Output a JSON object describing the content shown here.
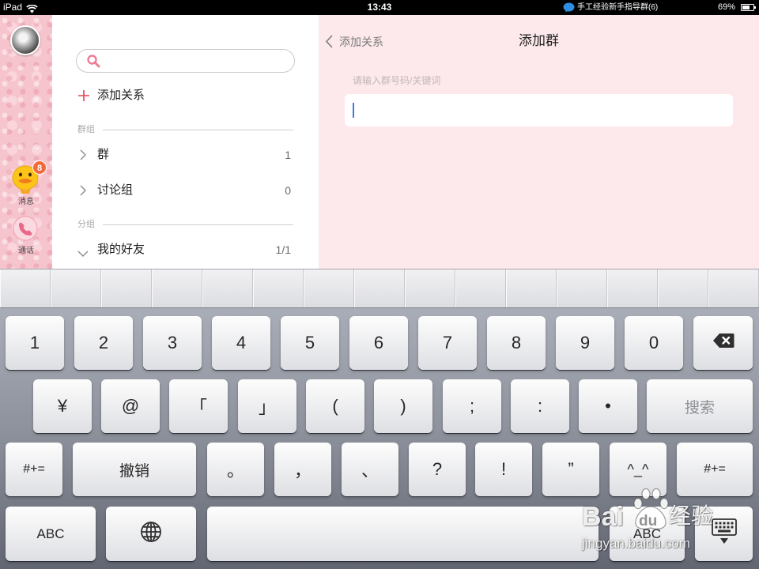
{
  "status_bar": {
    "device": "iPad",
    "time": "13:43",
    "notification_icon": "chat-bubble-icon",
    "notification": "手工经验新手指导群(6)",
    "battery": "69%",
    "battery_level": 0.69
  },
  "sidebar": {
    "items": [
      {
        "label": "消息",
        "badge": "8",
        "icon": "duck-icon"
      },
      {
        "label": "通话",
        "icon": "phone-icon"
      }
    ]
  },
  "contacts": {
    "search_icon": "search-icon",
    "add_relation": "添加关系",
    "sections": [
      {
        "title": "群组",
        "rows": [
          {
            "label": "群",
            "count": "1",
            "icon": "chevron-right-icon"
          },
          {
            "label": "讨论组",
            "count": "0",
            "icon": "chevron-right-icon"
          }
        ]
      },
      {
        "title": "分组",
        "rows": [
          {
            "label": "我的好友",
            "count": "1/1",
            "icon": "chevron-down-icon"
          }
        ]
      }
    ]
  },
  "add_group": {
    "back_label": "添加关系",
    "title": "添加群",
    "field_label": "请输入群号码/关键词"
  },
  "keyboard": {
    "row1": [
      "1",
      "2",
      "3",
      "4",
      "5",
      "6",
      "7",
      "8",
      "9",
      "0"
    ],
    "row1_end_icon": "delete-icon",
    "row2": [
      "¥",
      "@",
      "「",
      "」",
      "(",
      ")",
      ";",
      ":",
      "•"
    ],
    "search_key": "搜索",
    "row3": [
      "#+=",
      "撤销",
      "。",
      "，",
      "、",
      "?",
      "!",
      "”",
      "^_^",
      "#+="
    ],
    "row4": {
      "left": "ABC",
      "left_icon": "globe-icon",
      "right": "ABC",
      "right_icon": "keyboard-dismiss-icon"
    }
  },
  "watermark": {
    "brand_left": "Bai",
    "brand_mid": "du",
    "brand_right": "经验",
    "url": "jingyan.baidu.com"
  },
  "colors": {
    "status_bar_bg": "#000000",
    "sidebar_bg": "#f5c4cd",
    "list_bg": "#ffffff",
    "detail_bg": "#fde9ec",
    "accent_red": "#e2434e",
    "badge": "#f4693a",
    "cursor": "#3d7be0",
    "keyboard_top": "#a9adb7",
    "keyboard_bottom": "#626672"
  }
}
